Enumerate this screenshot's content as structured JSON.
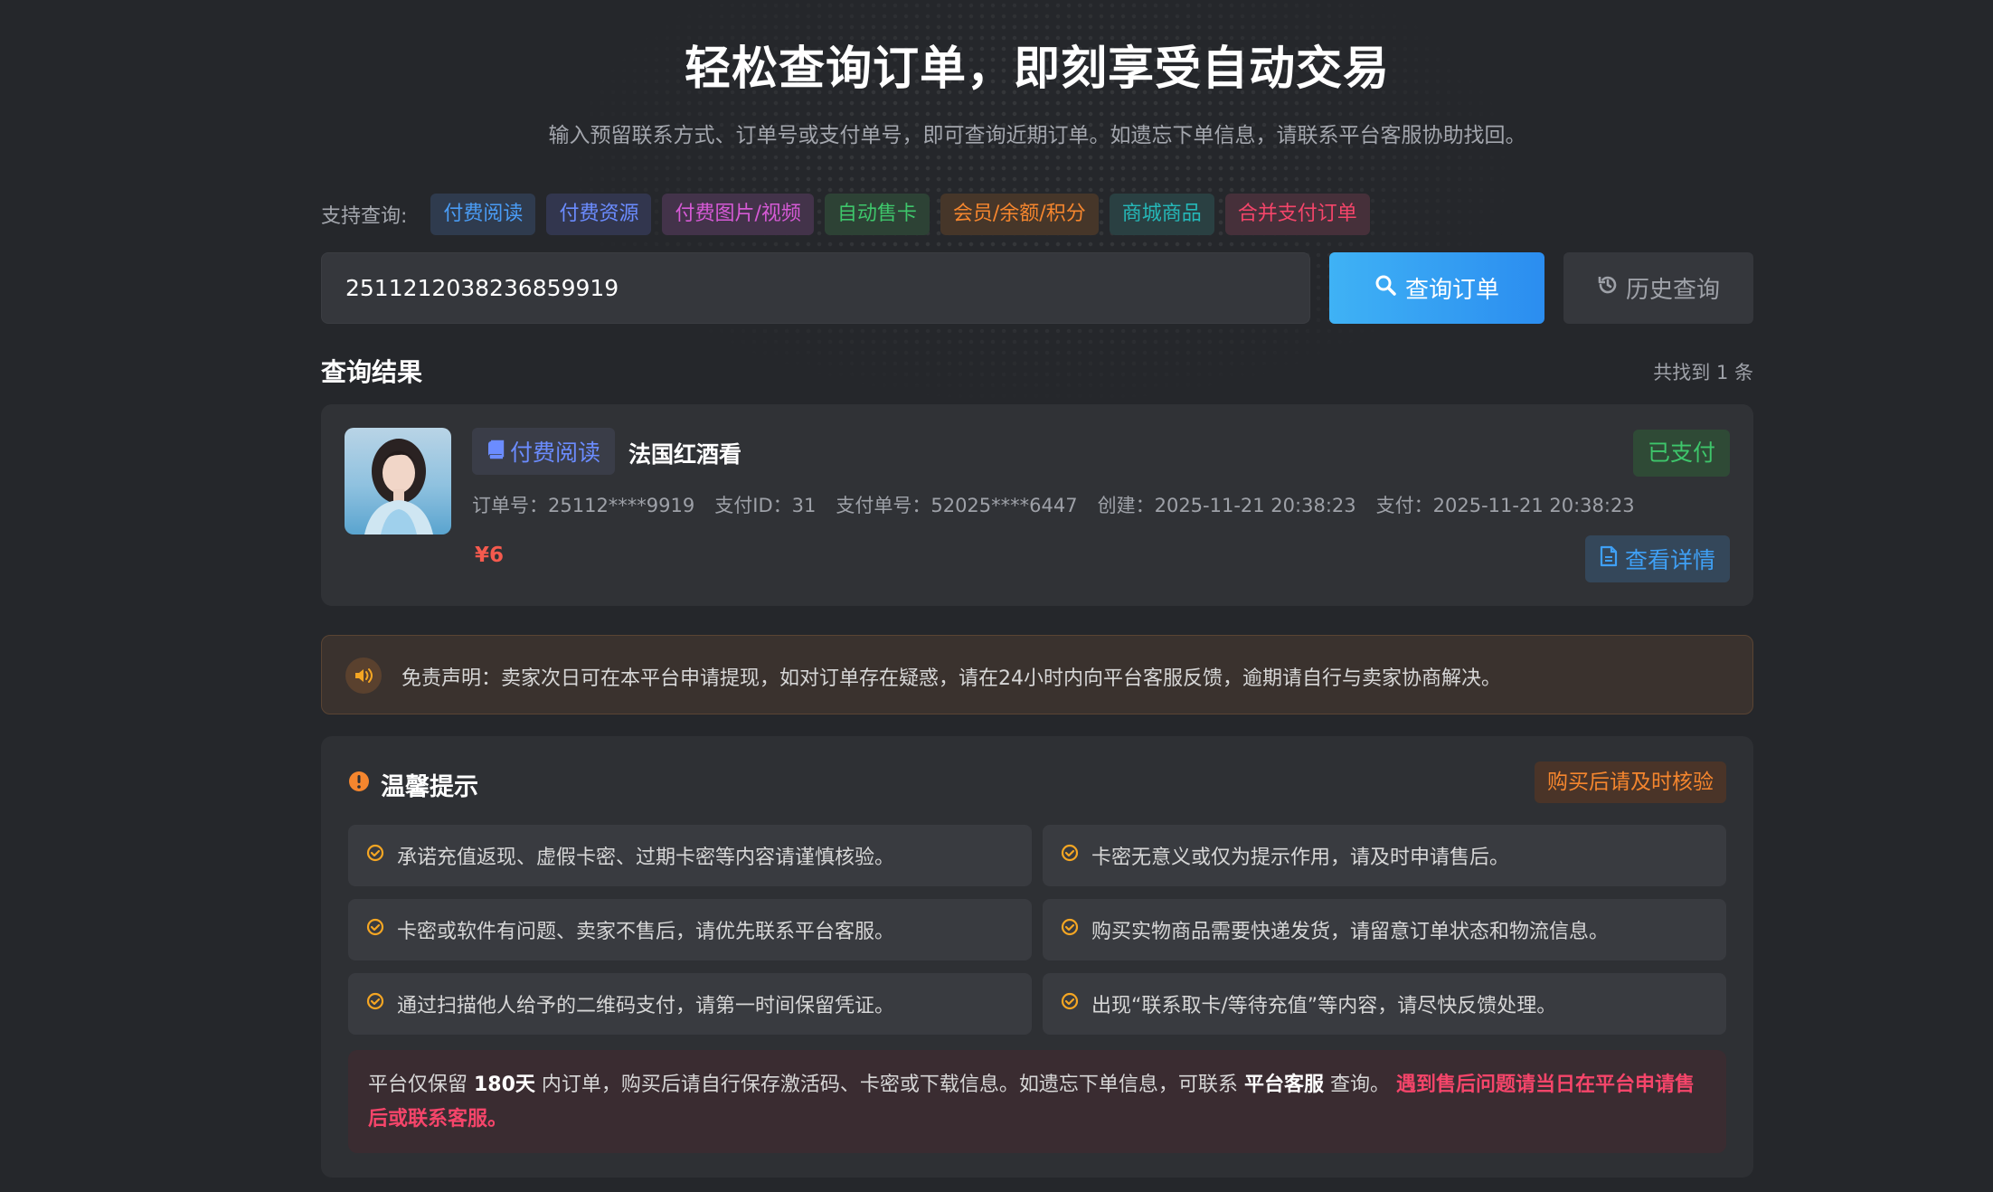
{
  "hero": {
    "title": "轻松查询订单，即刻享受自动交易",
    "subtitle": "输入预留联系方式、订单号或支付单号，即可查询近期订单。如遗忘下单信息，请联系平台客服协助找回。"
  },
  "support": {
    "label": "支持查询:",
    "tags": [
      {
        "label": "付费阅读",
        "color": "#4a9cf5",
        "bg": "#2f3b4e"
      },
      {
        "label": "付费资源",
        "color": "#6b8cff",
        "bg": "#32364e"
      },
      {
        "label": "付费图片/视频",
        "color": "#d65ad6",
        "bg": "#43334a"
      },
      {
        "label": "自动售卡",
        "color": "#3ec66b",
        "bg": "#2d4235"
      },
      {
        "label": "会员/余额/积分",
        "color": "#f5862e",
        "bg": "#463629"
      },
      {
        "label": "商城商品",
        "color": "#25b8b8",
        "bg": "#2a4042"
      },
      {
        "label": "合并支付订单",
        "color": "#f5456a",
        "bg": "#46303a"
      }
    ]
  },
  "search": {
    "value": "2511212038236859919",
    "query_button": "查询订单",
    "history_button": "历史查询"
  },
  "results": {
    "title": "查询结果",
    "count": "共找到 1 条",
    "order": {
      "type_label": "付费阅读",
      "name": "法国红酒看",
      "status": "已支付",
      "order_no": "订单号：25112****9919",
      "pay_id": "支付ID：31",
      "pay_no": "支付单号：52025****6447",
      "created": "创建：2025-11-21 20:38:23",
      "paid": "支付：2025-11-21 20:38:23",
      "price": "¥6",
      "detail_button": "查看详情"
    }
  },
  "disclaimer": {
    "text": "免责声明：卖家次日可在本平台申请提现，如对订单存在疑惑，请在24小时内向平台客服反馈，逾期请自行与卖家协商解决。"
  },
  "tips": {
    "title": "温馨提示",
    "badge": "购买后请及时核验",
    "items": [
      "承诺充值返现、虚假卡密、过期卡密等内容请谨慎核验。",
      "卡密无意义或仅为提示作用，请及时申请售后。",
      "卡密或软件有问题、卖家不售后，请优先联系平台客服。",
      "购买实物商品需要快递发货，请留意订单状态和物流信息。",
      "通过扫描他人给予的二维码支付，请第一时间保留凭证。",
      "出现“联系取卡/等待充值”等内容，请尽快反馈处理。"
    ],
    "note": {
      "part1": "平台仅保留 ",
      "days": "180天",
      "part2": " 内订单，购买后请自行保存激活码、卡密或下载信息。如遗忘下单信息，可联系 ",
      "service": "平台客服",
      "part3": " 查询。 ",
      "warn": "遇到售后问题请当日在平台申请售后或联系客服。"
    }
  }
}
